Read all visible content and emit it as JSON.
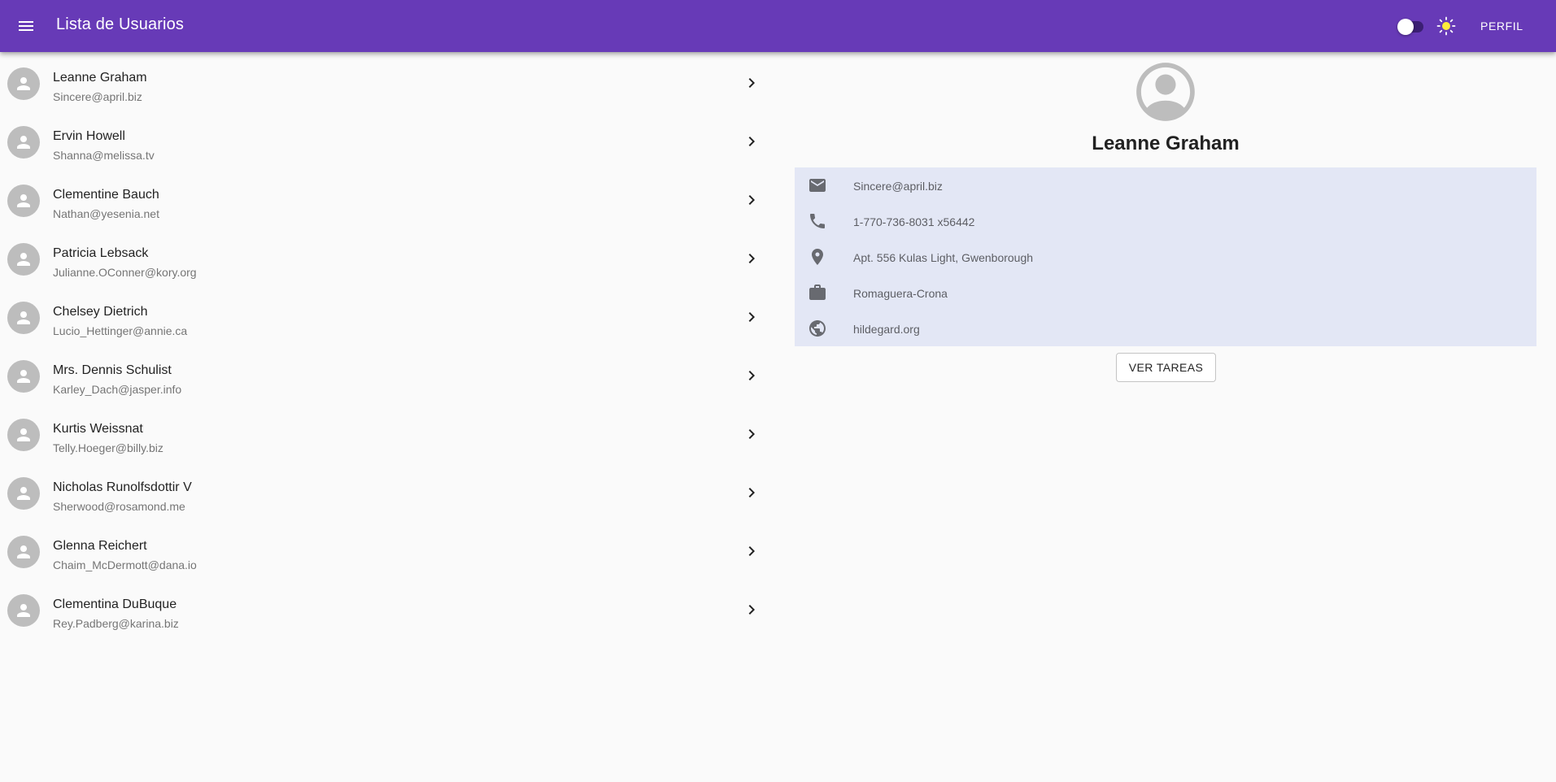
{
  "appbar": {
    "title": "Lista de Usuarios",
    "profile_label": "PERFIL",
    "color": "#673ab7",
    "theme_toggle": {
      "state": "off",
      "icon": "sun-icon"
    }
  },
  "users": [
    {
      "name": "Leanne Graham",
      "email": "Sincere@april.biz"
    },
    {
      "name": "Ervin Howell",
      "email": "Shanna@melissa.tv"
    },
    {
      "name": "Clementine Bauch",
      "email": "Nathan@yesenia.net"
    },
    {
      "name": "Patricia Lebsack",
      "email": "Julianne.OConner@kory.org"
    },
    {
      "name": "Chelsey Dietrich",
      "email": "Lucio_Hettinger@annie.ca"
    },
    {
      "name": "Mrs. Dennis Schulist",
      "email": "Karley_Dach@jasper.info"
    },
    {
      "name": "Kurtis Weissnat",
      "email": "Telly.Hoeger@billy.biz"
    },
    {
      "name": "Nicholas Runolfsdottir V",
      "email": "Sherwood@rosamond.me"
    },
    {
      "name": "Glenna Reichert",
      "email": "Chaim_McDermott@dana.io"
    },
    {
      "name": "Clementina DuBuque",
      "email": "Rey.Padberg@karina.biz"
    }
  ],
  "detail": {
    "name": "Leanne Graham",
    "email": "Sincere@april.biz",
    "phone": "1-770-736-8031 x56442",
    "address": "Apt. 556 Kulas Light, Gwenborough",
    "company": "Romaguera-Crona",
    "website": "hildegard.org",
    "tasks_button": "VER TAREAS",
    "info_bg": "#e3e7f5"
  }
}
